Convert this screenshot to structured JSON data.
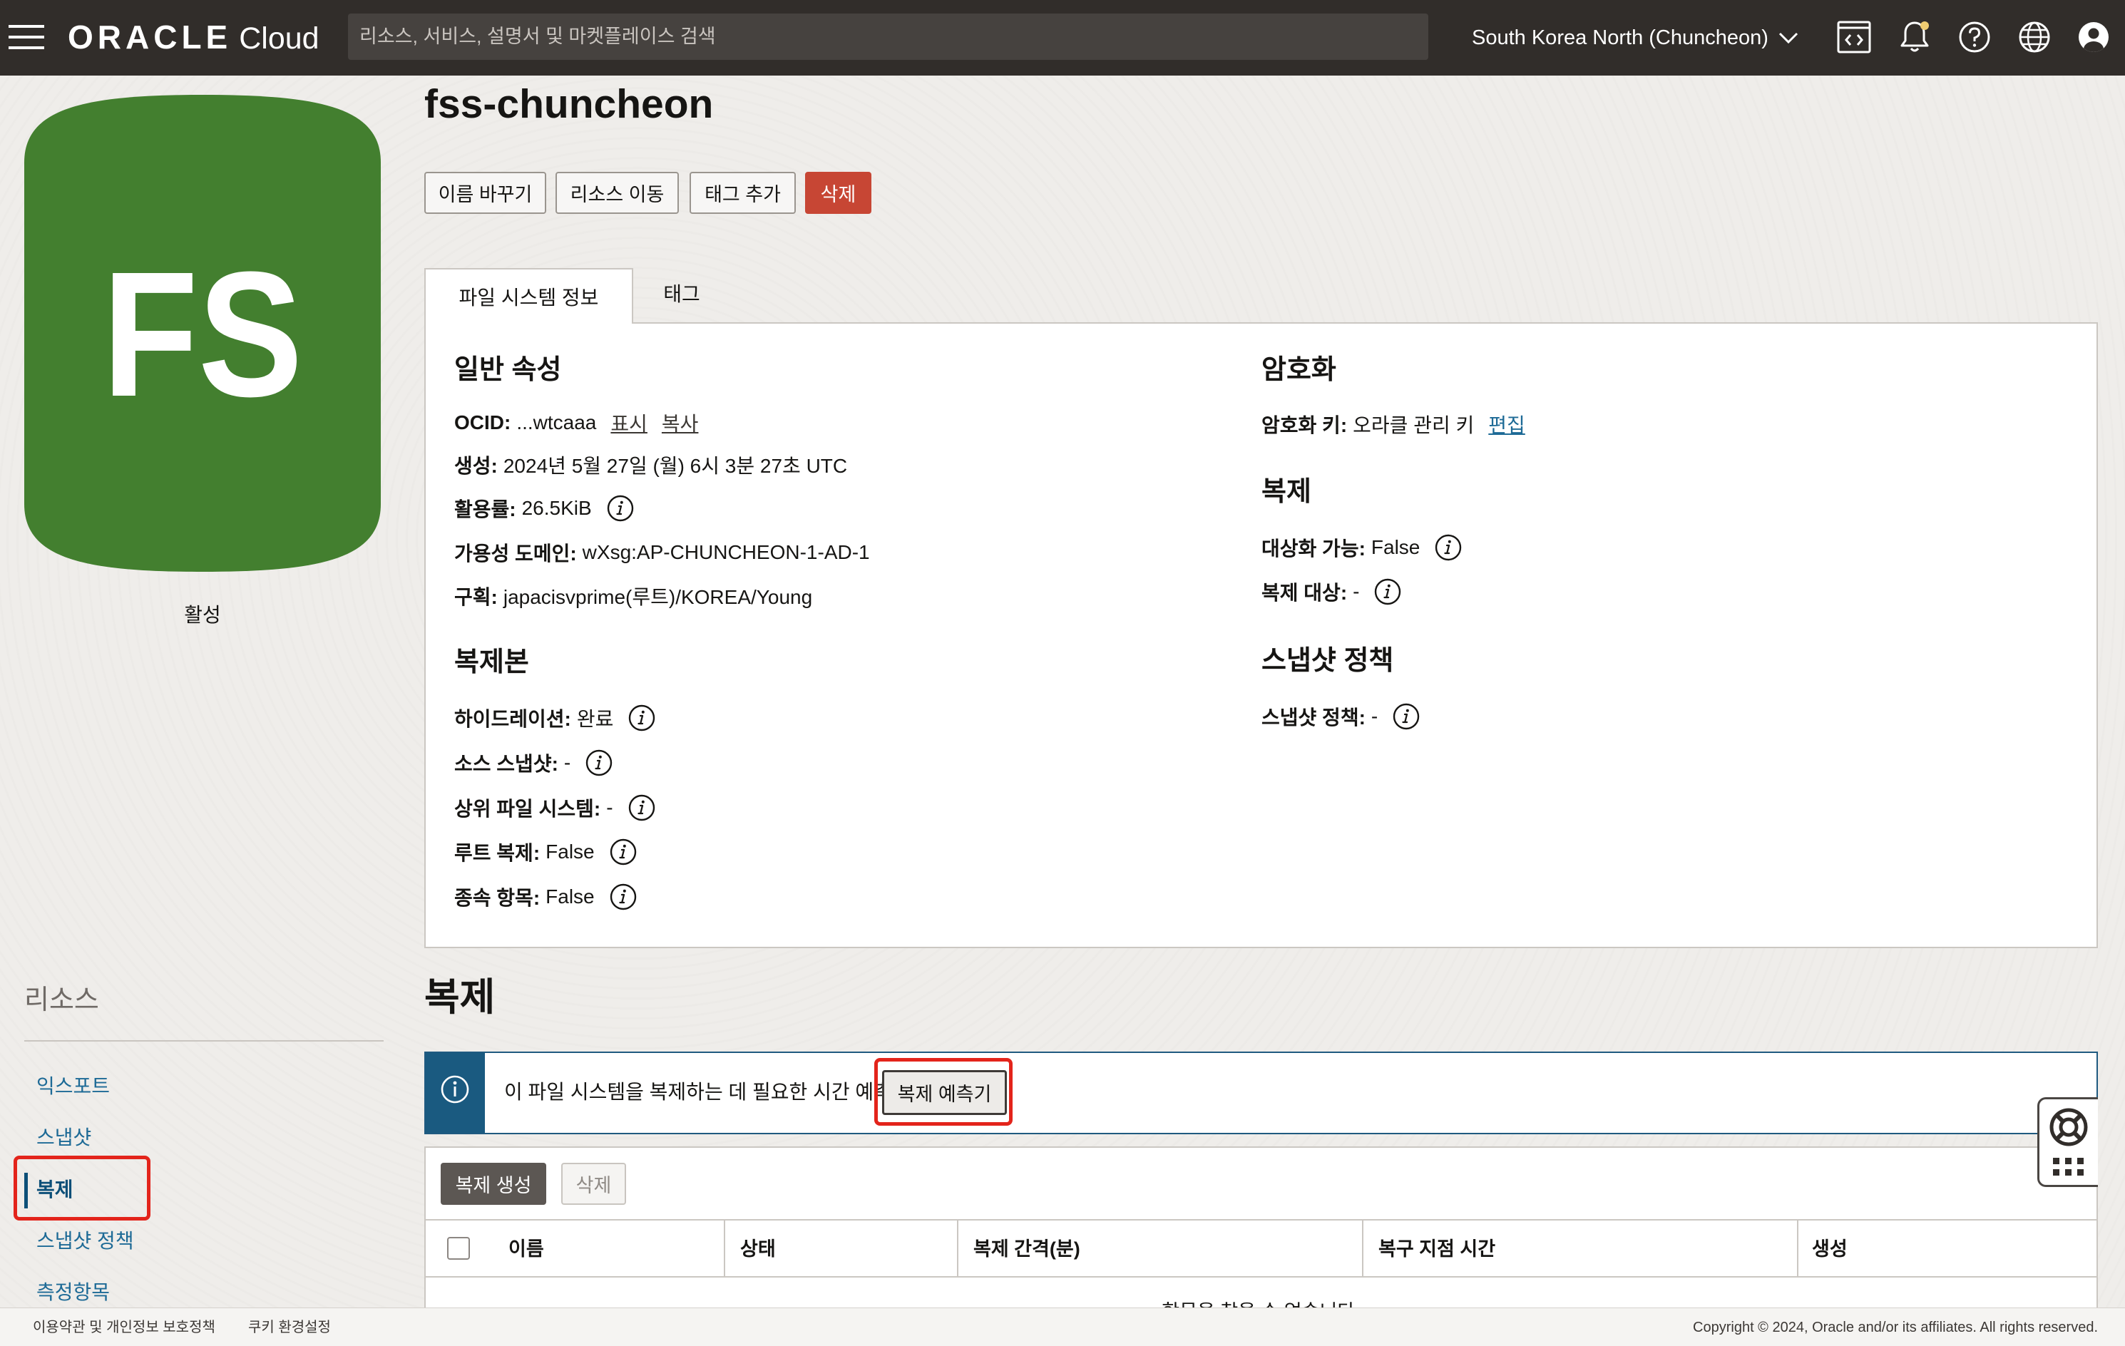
{
  "header": {
    "logo_oracle": "ORACLE",
    "logo_cloud": "Cloud",
    "search_placeholder": "리소스, 서비스, 설명서 및 마켓플레이스 검색",
    "region": "South Korea North (Chuncheon)",
    "icons": {
      "menu": "menu-icon",
      "code_editor": "code-editor-icon",
      "notifications": "bell-icon",
      "help": "help-icon",
      "language": "globe-icon",
      "profile": "profile-icon"
    },
    "notification_dot_color": "#F0CC71"
  },
  "sidebar": {
    "badge": {
      "text": "FS",
      "color": "#437F2F"
    },
    "status": "활성",
    "resources_title": "리소스",
    "items": [
      {
        "label": "익스포트",
        "active": false
      },
      {
        "label": "스냅샷",
        "active": false
      },
      {
        "label": "복제",
        "active": true
      },
      {
        "label": "스냅샷 정책",
        "active": false
      },
      {
        "label": "측정항목",
        "active": false
      }
    ]
  },
  "page": {
    "title": "fss-chuncheon",
    "actions": [
      {
        "label": "이름 바꾸기"
      },
      {
        "label": "리소스 이동"
      },
      {
        "label": "태그 추가"
      },
      {
        "label": "삭제",
        "danger": true
      }
    ],
    "tabs": [
      {
        "label": "파일 시스템 정보",
        "selected": true
      },
      {
        "label": "태그",
        "selected": false
      }
    ]
  },
  "details": {
    "general": {
      "heading": "일반 속성",
      "ocid": {
        "label": "OCID:",
        "value": "...wtcaaa",
        "show": "표시",
        "copy": "복사"
      },
      "created": {
        "label": "생성:",
        "value": "2024년 5월 27일 (월) 6시 3분 27초 UTC"
      },
      "utilization": {
        "label": "활용률:",
        "value": "26.5KiB"
      },
      "availability_domain": {
        "label": "가용성 도메인:",
        "value": "wXsg:AP-CHUNCHEON-1-AD-1"
      },
      "compartment": {
        "label": "구획:",
        "value": "japacisvprime(루트)/KOREA/Young"
      }
    },
    "clone": {
      "heading": "복제본",
      "hydration": {
        "label": "하이드레이션:",
        "value": "완료"
      },
      "source_snapshot": {
        "label": "소스 스냅샷:",
        "value": "-"
      },
      "parent_file_system": {
        "label": "상위 파일 시스템:",
        "value": "-"
      },
      "root_clone": {
        "label": "루트 복제:",
        "value": "False"
      },
      "dependents": {
        "label": "종속 항목:",
        "value": "False"
      }
    },
    "encryption": {
      "heading": "암호화",
      "key": {
        "label": "암호화 키:",
        "value": "오라클 관리 키",
        "edit": "편집"
      }
    },
    "replication": {
      "heading": "복제",
      "targetable": {
        "label": "대상화 가능:",
        "value": "False"
      },
      "target": {
        "label": "복제 대상:",
        "value": "-"
      }
    },
    "snapshot_policy": {
      "heading": "스냅샷 정책",
      "policy": {
        "label": "스냅샷 정책:",
        "value": "-"
      }
    }
  },
  "replications": {
    "heading": "복제",
    "banner": {
      "text": "이 파일 시스템을 복제하는 데 필요한 시간 예측",
      "button": "복제 예측기"
    },
    "toolbar": {
      "create": "복제 생성",
      "delete": "삭제"
    },
    "columns": [
      "이름",
      "상태",
      "복제 간격(분)",
      "복구 지점 시간",
      "생성"
    ],
    "empty_text": "항목을 찾을 수 없습니다."
  },
  "footer": {
    "terms": "이용약관 및 개인정보 보호정책",
    "cookies": "쿠키 환경설정",
    "copyright": "Copyright © 2024, Oracle and/or its affiliates. All rights reserved."
  },
  "colors": {
    "header_bg": "#312D2A",
    "danger": "#C74634",
    "link": "#1D6A96",
    "banner_accent": "#1A5A80",
    "highlight": "#E3241B"
  }
}
